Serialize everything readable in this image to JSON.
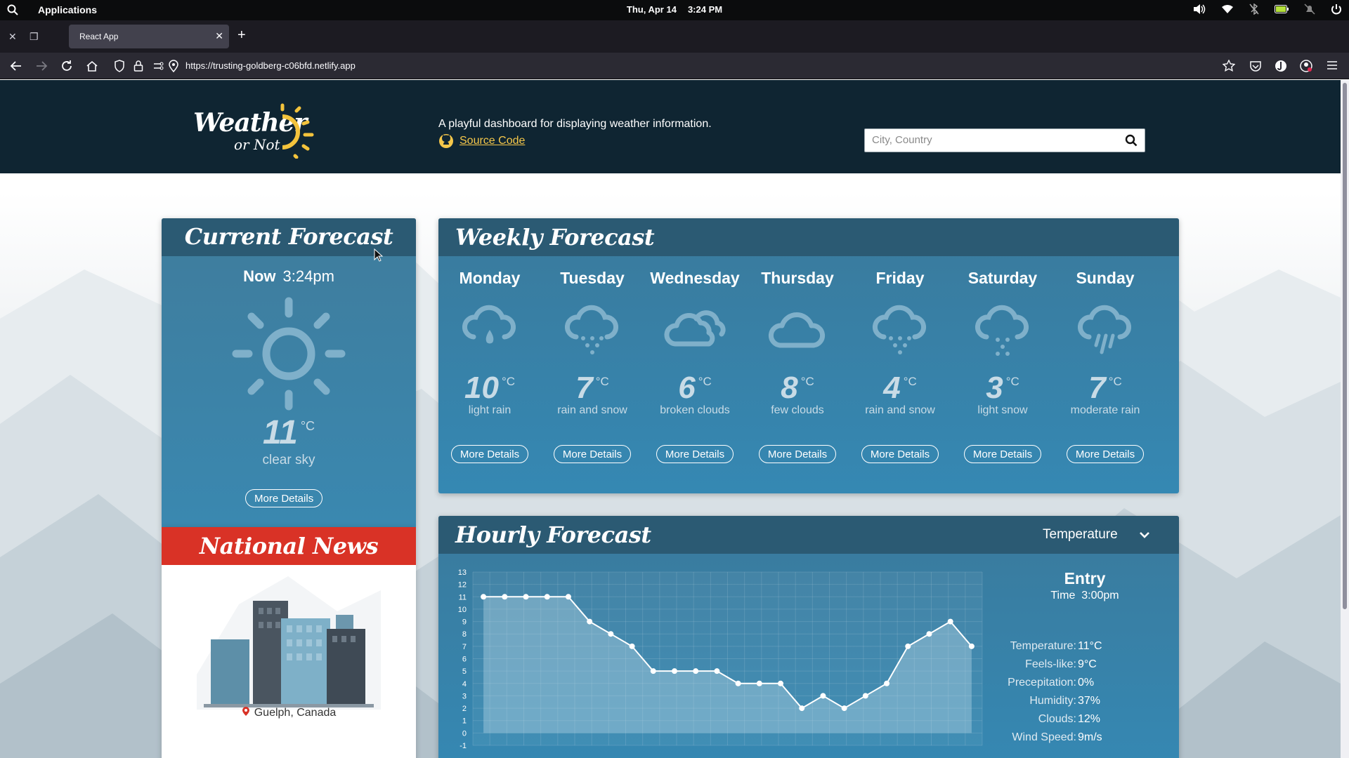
{
  "os": {
    "apps_label": "Applications",
    "date": "Thu, Apr 14",
    "time": "3:24 PM"
  },
  "browser": {
    "tab_title": "React App",
    "url_host": "https://trusting-goldberg-c06bfd.netlify.app"
  },
  "header": {
    "logo_line1": "Weather",
    "logo_line2": "or Not",
    "tagline": "A playful dashboard for displaying weather information.",
    "source_link": "Source Code",
    "search_placeholder": "City, Country"
  },
  "current": {
    "title": "Current Forecast",
    "now_label": "Now",
    "time": "3:24pm",
    "temp": "11",
    "unit": "°C",
    "condition": "clear sky",
    "icon": "sun-icon",
    "button": "More Details"
  },
  "news": {
    "title": "National News",
    "location": "Guelph, Canada"
  },
  "weekly": {
    "title": "Weekly Forecast",
    "button_label": "More Details",
    "unit": "°C",
    "days": [
      {
        "name": "Monday",
        "temp": "10",
        "desc": "light rain",
        "icon": "rain-drop-icon"
      },
      {
        "name": "Tuesday",
        "temp": "7",
        "desc": "rain and snow",
        "icon": "sleet-icon"
      },
      {
        "name": "Wednesday",
        "temp": "6",
        "desc": "broken clouds",
        "icon": "clouds-icon"
      },
      {
        "name": "Thursday",
        "temp": "8",
        "desc": "few clouds",
        "icon": "cloud-icon"
      },
      {
        "name": "Friday",
        "temp": "4",
        "desc": "rain and snow",
        "icon": "sleet-icon"
      },
      {
        "name": "Saturday",
        "temp": "3",
        "desc": "light snow",
        "icon": "snow-icon"
      },
      {
        "name": "Sunday",
        "temp": "7",
        "desc": "moderate rain",
        "icon": "rain-icon"
      }
    ]
  },
  "hourly": {
    "title": "Hourly Forecast",
    "selected_metric": "Temperature",
    "entry": {
      "title": "Entry",
      "time_label": "Time",
      "time": "3:00pm",
      "rows": [
        {
          "k": "Temperature:",
          "v": "11°C"
        },
        {
          "k": "Feels-like:",
          "v": "9°C"
        },
        {
          "k": "Precepitation:",
          "v": "0%"
        },
        {
          "k": "Humidity:",
          "v": "37%"
        },
        {
          "k": "Clouds:",
          "v": "12%"
        },
        {
          "k": "Wind Speed:",
          "v": "9m/s"
        }
      ]
    }
  },
  "chart_data": {
    "type": "area",
    "title": "",
    "xlabel": "",
    "ylabel": "",
    "ylim": [
      -1,
      13
    ],
    "y_ticks": [
      13,
      12,
      11,
      10,
      9,
      8,
      7,
      6,
      5,
      4,
      3,
      2,
      1,
      0,
      -1
    ],
    "grid": true,
    "series": [
      {
        "values": [
          11,
          11,
          11,
          11,
          11,
          9,
          8,
          7,
          5,
          5,
          5,
          5,
          4,
          4,
          4,
          2,
          3,
          2,
          3,
          4,
          7,
          8,
          9,
          7
        ]
      }
    ]
  }
}
